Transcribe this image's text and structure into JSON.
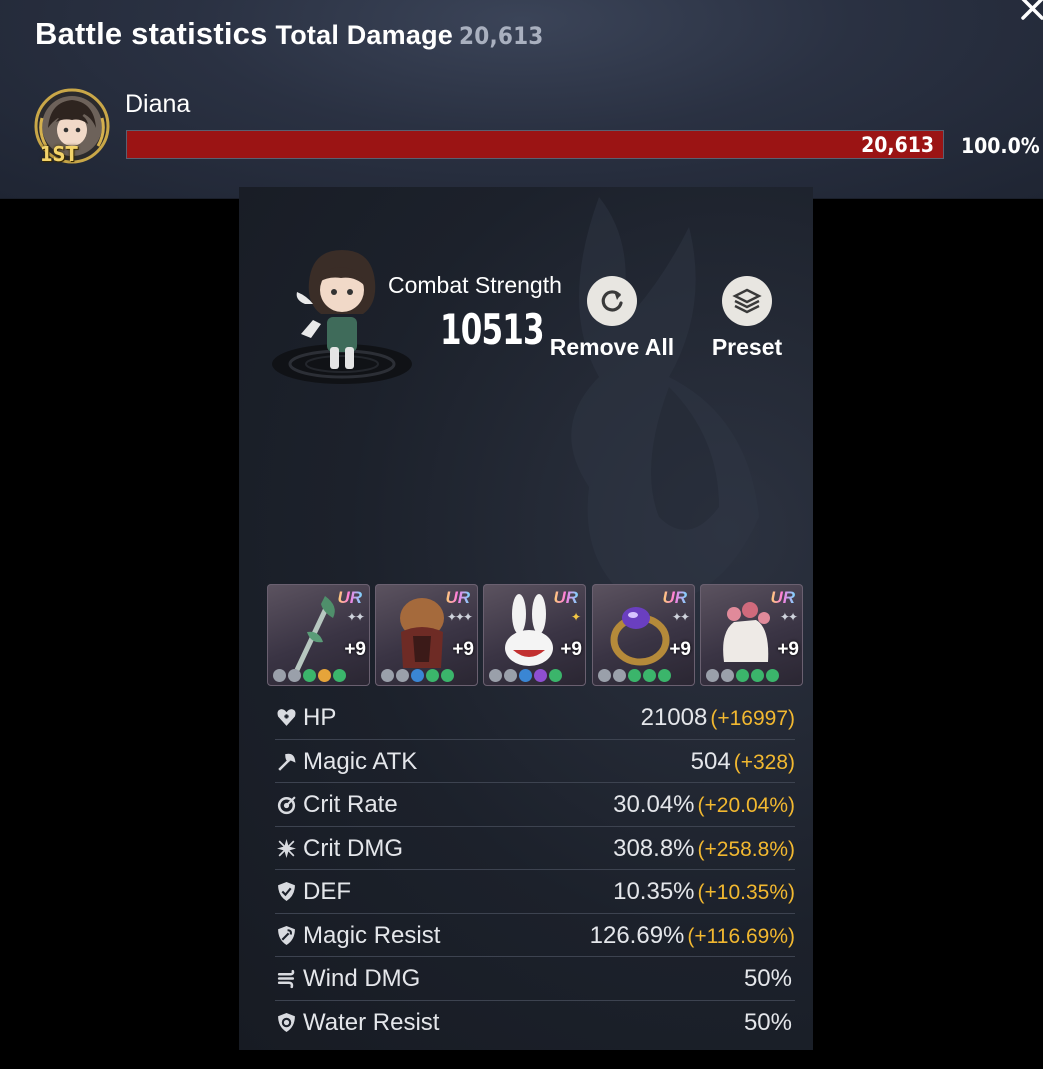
{
  "header": {
    "title": "Battle statistics",
    "total_label": "Total Damage",
    "total_value": "20,613"
  },
  "ranking": [
    {
      "rank": "1ST",
      "name": "Diana",
      "damage": "20,613",
      "percent_label": "100.0%",
      "percent": 100.0
    }
  ],
  "character": {
    "combat_strength_label": "Combat Strength",
    "combat_strength_value": "10513",
    "remove_all_label": "Remove All",
    "preset_label": "Preset"
  },
  "equipment": [
    {
      "rarity": "UR",
      "level": "+9",
      "item": "staff-icon"
    },
    {
      "rarity": "UR",
      "level": "+9",
      "item": "armor-icon"
    },
    {
      "rarity": "UR",
      "level": "+9",
      "item": "bunny-helm-icon"
    },
    {
      "rarity": "UR",
      "level": "+9",
      "item": "ring-icon"
    },
    {
      "rarity": "UR",
      "level": "+9",
      "item": "gloves-icon"
    }
  ],
  "stats": [
    {
      "icon": "hp-icon",
      "name": "HP",
      "value": "21008",
      "bonus": "(+16997)"
    },
    {
      "icon": "magic-atk-icon",
      "name": "Magic ATK",
      "value": "504",
      "bonus": "(+328)"
    },
    {
      "icon": "crit-rate-icon",
      "name": "Crit Rate",
      "value": "30.04%",
      "bonus": "(+20.04%)"
    },
    {
      "icon": "crit-dmg-icon",
      "name": "Crit DMG",
      "value": "308.8%",
      "bonus": "(+258.8%)"
    },
    {
      "icon": "def-icon",
      "name": "DEF",
      "value": "10.35%",
      "bonus": "(+10.35%)"
    },
    {
      "icon": "magic-resist-icon",
      "name": "Magic Resist",
      "value": "126.69%",
      "bonus": "(+116.69%)"
    },
    {
      "icon": "wind-dmg-icon",
      "name": "Wind DMG",
      "value": "50%",
      "bonus": ""
    },
    {
      "icon": "water-resist-icon",
      "name": "Water Resist",
      "value": "50%",
      "bonus": ""
    }
  ],
  "colors": {
    "damage_bar": "#9b1414",
    "bonus_text": "#f2b830",
    "rank_gold": "#f3d36a"
  }
}
